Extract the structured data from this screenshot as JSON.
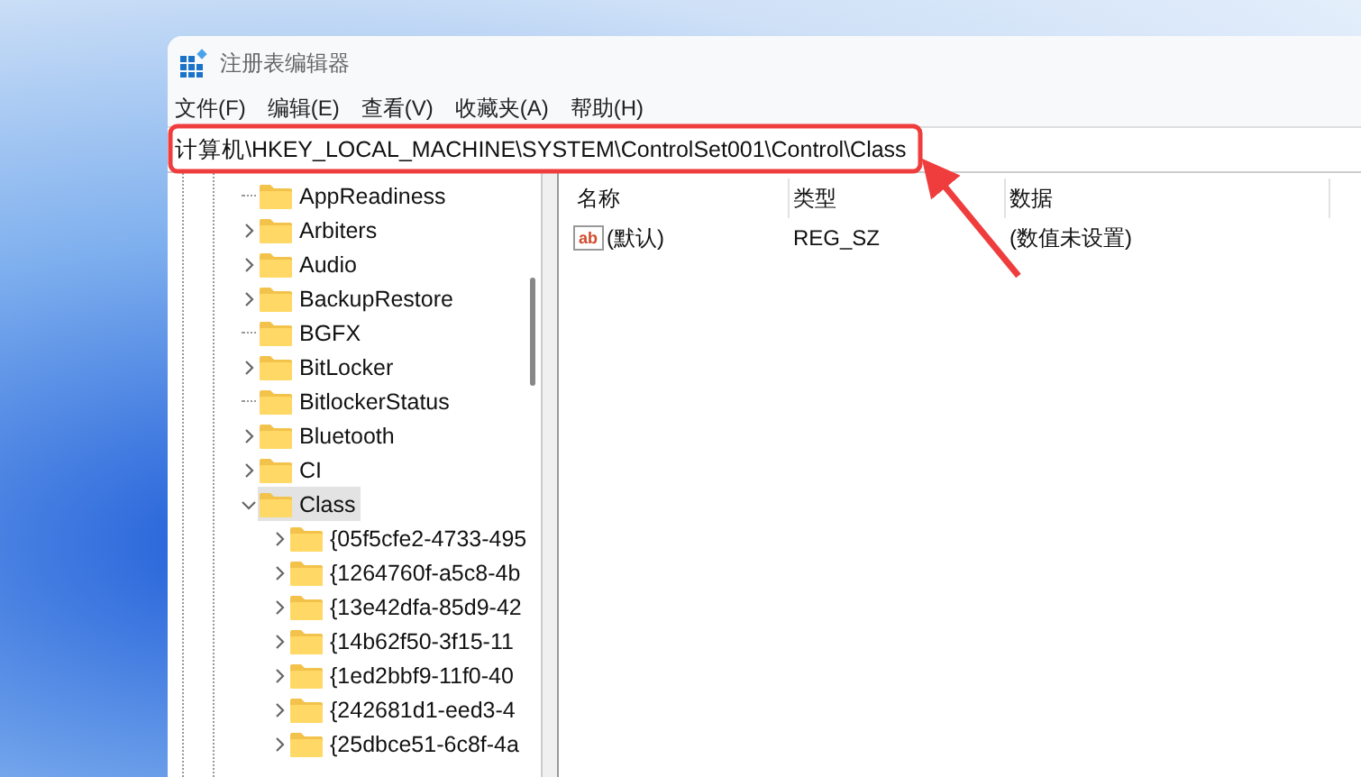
{
  "window": {
    "title": "注册表编辑器"
  },
  "menu": [
    {
      "label": "文件(F)"
    },
    {
      "label": "编辑(E)"
    },
    {
      "label": "查看(V)"
    },
    {
      "label": "收藏夹(A)"
    },
    {
      "label": "帮助(H)"
    }
  ],
  "address_bar": {
    "value": "计算机\\HKEY_LOCAL_MACHINE\\SYSTEM\\ControlSet001\\Control\\Class"
  },
  "tree": [
    {
      "label": "AppReadiness",
      "selected": false
    },
    {
      "label": "Arbiters",
      "expanded": false,
      "selected": false
    },
    {
      "label": "Audio",
      "expanded": false,
      "selected": false
    },
    {
      "label": "BackupRestore",
      "expanded": false,
      "selected": false
    },
    {
      "label": "BGFX",
      "selected": false
    },
    {
      "label": "BitLocker",
      "expanded": false,
      "selected": false
    },
    {
      "label": "BitlockerStatus",
      "selected": false
    },
    {
      "label": "Bluetooth",
      "expanded": false,
      "selected": false
    },
    {
      "label": "CI",
      "expanded": false,
      "selected": false
    },
    {
      "label": "Class",
      "expanded": true,
      "selected": true,
      "children": [
        {
          "label": "{05f5cfe2-4733-495",
          "expanded": false,
          "selected": false
        },
        {
          "label": "{1264760f-a5c8-4b",
          "expanded": false,
          "selected": false
        },
        {
          "label": "{13e42dfa-85d9-42",
          "expanded": false,
          "selected": false
        },
        {
          "label": "{14b62f50-3f15-11",
          "expanded": false,
          "selected": false
        },
        {
          "label": "{1ed2bbf9-11f0-40",
          "expanded": false,
          "selected": false
        },
        {
          "label": "{242681d1-eed3-4",
          "expanded": false,
          "selected": false
        },
        {
          "label": "{25dbce51-6c8f-4a",
          "expanded": false,
          "selected": false
        }
      ]
    }
  ],
  "values_table": {
    "columns": [
      "名称",
      "类型",
      "数据"
    ],
    "rows": [
      {
        "icon_label": "ab",
        "name": "(默认)",
        "type": "REG_SZ",
        "data": "(数值未设置)"
      }
    ]
  }
}
